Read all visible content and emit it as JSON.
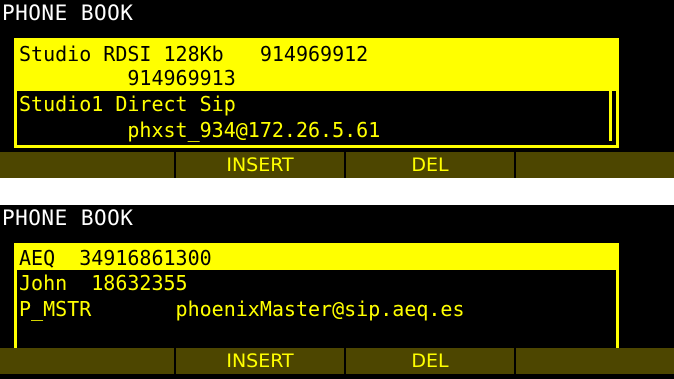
{
  "screen1": {
    "title": "PHONE BOOK",
    "entries": [
      {
        "line1": "Studio RDSI 128Kb   914969912",
        "line2": "         914969913"
      },
      {
        "line1": "Studio1 Direct Sip",
        "line2": "         phxst_934@172.26.5.61"
      }
    ],
    "softkeys": [
      "",
      "INSERT",
      "DEL",
      ""
    ]
  },
  "screen2": {
    "title": "PHONE BOOK",
    "entries": [
      {
        "line1": "AEQ  34916861300"
      },
      {
        "line1": "John  18632355"
      },
      {
        "line1": "P_MSTR       phoenixMaster@sip.aeq.es"
      }
    ],
    "softkeys": [
      "",
      "INSERT",
      "DEL",
      ""
    ]
  },
  "colors": {
    "lcd_bg": "#000000",
    "text": "#ffff00",
    "softkey_bg": "#4d4600",
    "title": "#ffffff"
  }
}
